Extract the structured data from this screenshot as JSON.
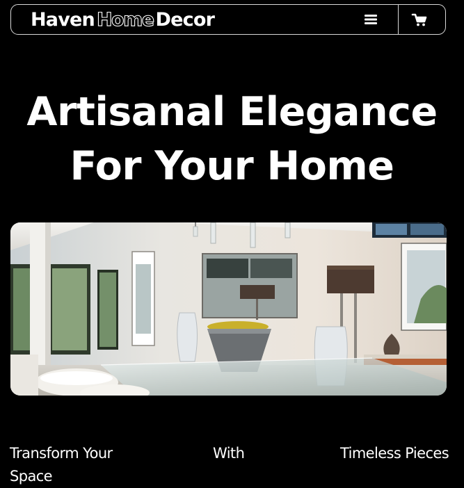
{
  "header": {
    "brand": {
      "word1": "Haven",
      "word2": "Home",
      "word3": "Decor"
    },
    "menu_icon": "hamburger-menu-icon",
    "cart_icon": "shopping-cart-icon"
  },
  "hero": {
    "title_line1": "Artisanal Elegance",
    "title_line2": "For Your Home",
    "image_subject": "modern dining room interior with glass table, pendant lights and lamps"
  },
  "tagline": {
    "part1": "Transform Your",
    "part1_wrap": "Space",
    "part2": "With",
    "part3": "Timeless Pieces"
  },
  "colors": {
    "background": "#000000",
    "text": "#ffffff",
    "border": "#d9d9d9"
  }
}
